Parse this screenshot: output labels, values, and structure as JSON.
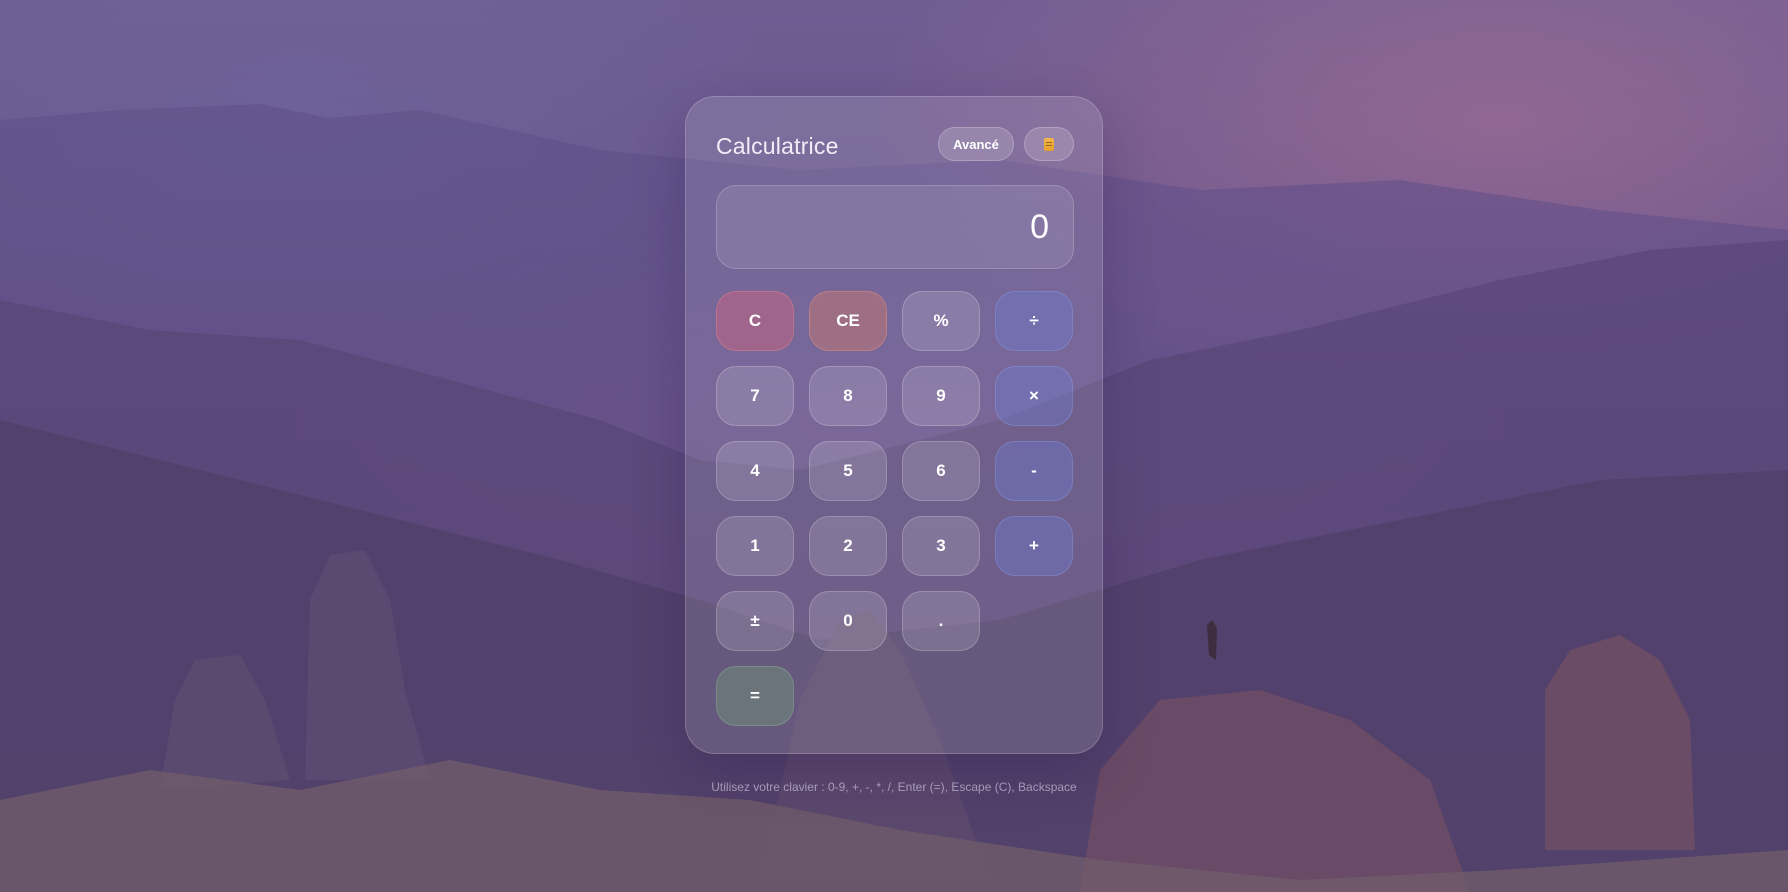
{
  "app": {
    "title": "Calculatrice",
    "advanced_label": "Avancé",
    "history_icon": "history-notepad-icon"
  },
  "display": {
    "value": "0"
  },
  "keys": {
    "clear": "C",
    "clear_entry": "CE",
    "percent": "%",
    "divide": "÷",
    "seven": "7",
    "eight": "8",
    "nine": "9",
    "multiply": "×",
    "four": "4",
    "five": "5",
    "six": "6",
    "subtract": "-",
    "one": "1",
    "two": "2",
    "three": "3",
    "add": "+",
    "plus_minus": "±",
    "zero": "0",
    "decimal": ".",
    "equals": "="
  },
  "hint": "Utilisez votre clavier : 0-9, +, -, *, /, Enter (=), Escape (C), Backspace",
  "colors": {
    "clear_key": "#dc6478",
    "clear_entry_key": "#d77d64",
    "operator_key": "#6e82dc",
    "equals_key": "#6e9678",
    "history_icon": "#f4b64a"
  }
}
